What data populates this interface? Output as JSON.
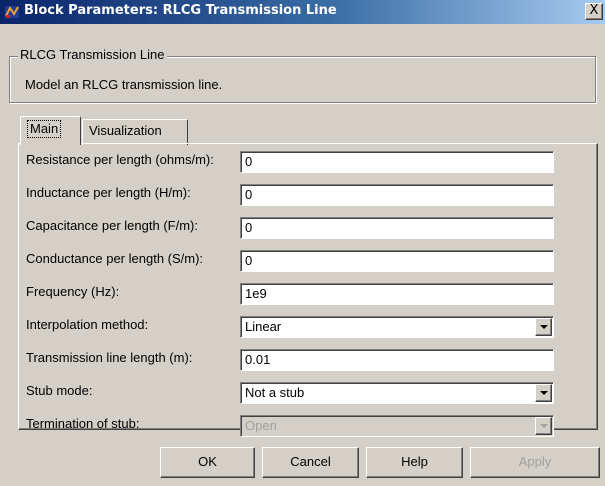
{
  "window": {
    "title": "Block Parameters: RLCG Transmission Line",
    "close_symbol": "X",
    "icon": "simulink-block-icon"
  },
  "group": {
    "legend": "RLCG Transmission Line",
    "description": "Model an RLCG transmission line."
  },
  "tabs": [
    {
      "label": "Main",
      "selected": true
    },
    {
      "label": "Visualization",
      "selected": false
    }
  ],
  "params": [
    {
      "label": "Resistance per length (ohms/m):",
      "value": "0",
      "kind": "edit"
    },
    {
      "label": "Inductance per length (H/m):",
      "value": "0",
      "kind": "edit"
    },
    {
      "label": "Capacitance per length (F/m):",
      "value": "0",
      "kind": "edit"
    },
    {
      "label": "Conductance per length (S/m):",
      "value": "0",
      "kind": "edit"
    },
    {
      "label": "Frequency (Hz):",
      "value": "1e9",
      "kind": "edit"
    },
    {
      "label": "Interpolation method:",
      "value": "Linear",
      "kind": "dropdown"
    },
    {
      "label": "Transmission line length (m):",
      "value": "0.01",
      "kind": "edit"
    },
    {
      "label": "Stub mode:",
      "value": "Not a stub",
      "kind": "dropdown"
    },
    {
      "label": "Termination of stub:",
      "value": "Open",
      "kind": "dropdown",
      "disabled": true
    }
  ],
  "buttons": {
    "ok": "OK",
    "cancel": "Cancel",
    "help": "Help",
    "apply": "Apply",
    "apply_disabled": true
  },
  "colors": {
    "dialog_bg": "#d4d0c8",
    "titlebar_start": "#0a246a",
    "titlebar_end": "#a6caf0",
    "disabled_text": "#a0a0a0"
  }
}
